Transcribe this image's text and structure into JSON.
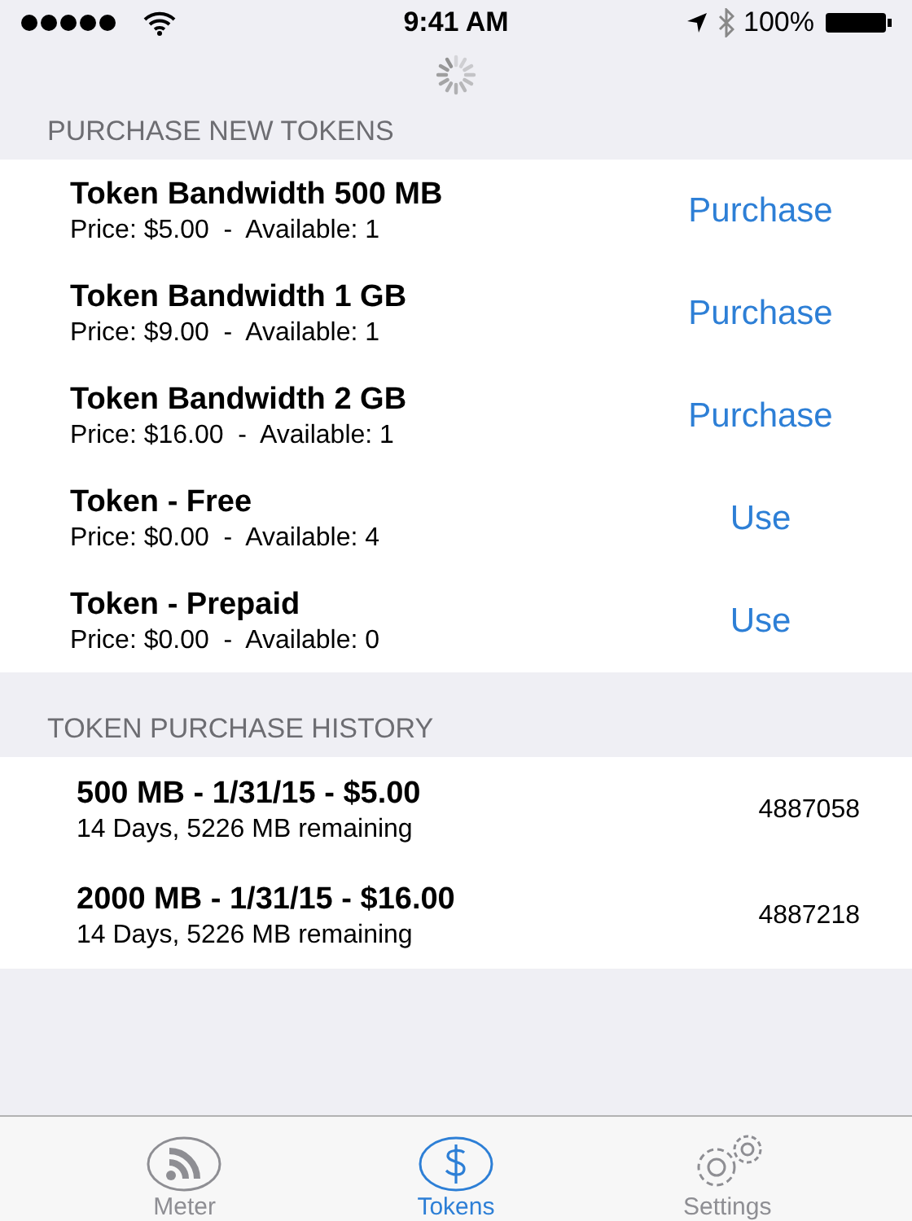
{
  "status_bar": {
    "time": "9:41 AM",
    "battery": "100%"
  },
  "purchase_section": {
    "title": "PURCHASE NEW TOKENS",
    "items": [
      {
        "name": "Token Bandwidth 500 MB",
        "details": "Price: $5.00  -  Available: 1",
        "action": "Purchase"
      },
      {
        "name": "Token Bandwidth 1 GB",
        "details": "Price: $9.00  -  Available: 1",
        "action": "Purchase"
      },
      {
        "name": "Token Bandwidth 2 GB",
        "details": "Price: $16.00  -  Available: 1",
        "action": "Purchase"
      },
      {
        "name": "Token - Free",
        "details": "Price: $0.00  -  Available: 4",
        "action": "Use"
      },
      {
        "name": "Token - Prepaid",
        "details": "Price: $0.00  -  Available: 0",
        "action": "Use"
      }
    ]
  },
  "history_section": {
    "title": "TOKEN PURCHASE HISTORY",
    "items": [
      {
        "summary": "500 MB - 1/31/15 - $5.00",
        "details": "14 Days, 5226 MB remaining",
        "id": "4887058"
      },
      {
        "summary": "2000 MB - 1/31/15 - $16.00",
        "details": "14 Days, 5226 MB remaining",
        "id": "4887218"
      }
    ]
  },
  "tab_bar": [
    {
      "label": "Meter",
      "kind": "meter",
      "selected": false
    },
    {
      "label": "Tokens",
      "kind": "tokens",
      "selected": true
    },
    {
      "label": "Settings",
      "kind": "settings",
      "selected": false
    }
  ]
}
